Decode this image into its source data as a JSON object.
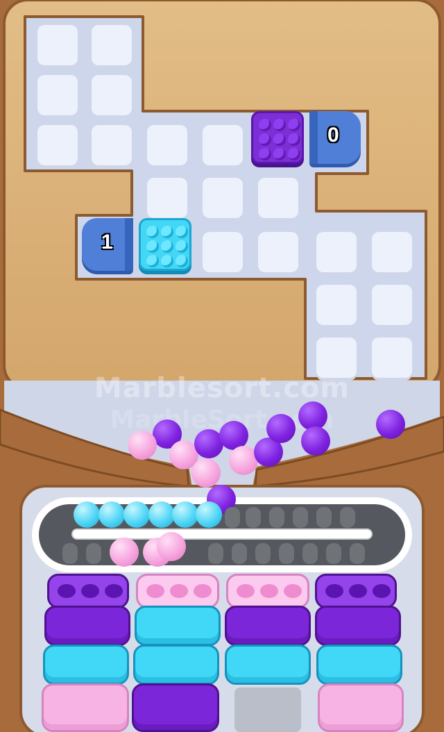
{
  "watermark": {
    "line1": "Marblesort.com",
    "line2": "MarbleSort.com"
  },
  "cannons": [
    {
      "id": "top-right",
      "count": "0",
      "faces": "left"
    },
    {
      "id": "middle-left",
      "count": "1",
      "faces": "right"
    }
  ],
  "pieces": [
    {
      "color": "purple",
      "marbles": 9
    },
    {
      "color": "cyan",
      "marbles": 9
    }
  ],
  "conveyor": {
    "marbles_on_belt": [
      "cyan",
      "cyan",
      "cyan",
      "cyan",
      "cyan",
      "cyan"
    ]
  },
  "sort_tubes": [
    {
      "column": 1,
      "top": "purple",
      "layers": [
        "purple",
        "cyan",
        "pink"
      ]
    },
    {
      "column": 2,
      "top": "pink",
      "layers": [
        "cyan",
        "cyan",
        "purple"
      ]
    },
    {
      "column": 3,
      "top": "pink",
      "layers": [
        "purple",
        "cyan"
      ]
    },
    {
      "column": 4,
      "top": "purple",
      "layers": [
        "purple",
        "cyan",
        "pink"
      ]
    }
  ],
  "colors": {
    "board_wood": "#d8b07a",
    "frame_wood": "#a86c3c",
    "tile": "#edf1fb",
    "purple": "#7d2fd6",
    "cyan": "#43d6f5",
    "pink": "#f6b3e3",
    "cannon": "#4f7fd7"
  }
}
